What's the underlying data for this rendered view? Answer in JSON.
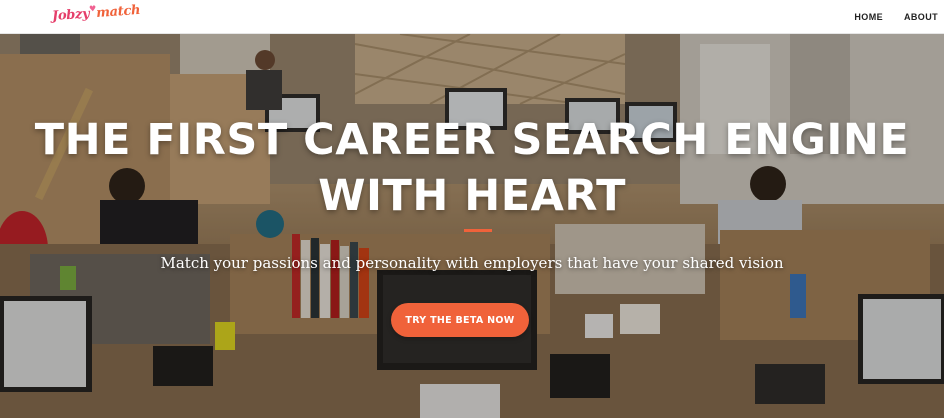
{
  "nav": {
    "logo_part1": "Jobzy",
    "logo_part2": "match",
    "links": [
      "HOME",
      "ABOUT"
    ]
  },
  "hero": {
    "title_line1": "THE FIRST CAREER SEARCH ENGINE",
    "title_line2": "WITH HEART",
    "subtitle": "Match your passions and personality with employers that have your shared vision",
    "cta_label": "TRY THE BETA NOW",
    "accent_color": "#f0623a"
  },
  "colors": {
    "brand_pink": "#e53e6a",
    "brand_orange": "#f0623a"
  },
  "icons": {
    "logo_heart": "heart-icon"
  }
}
